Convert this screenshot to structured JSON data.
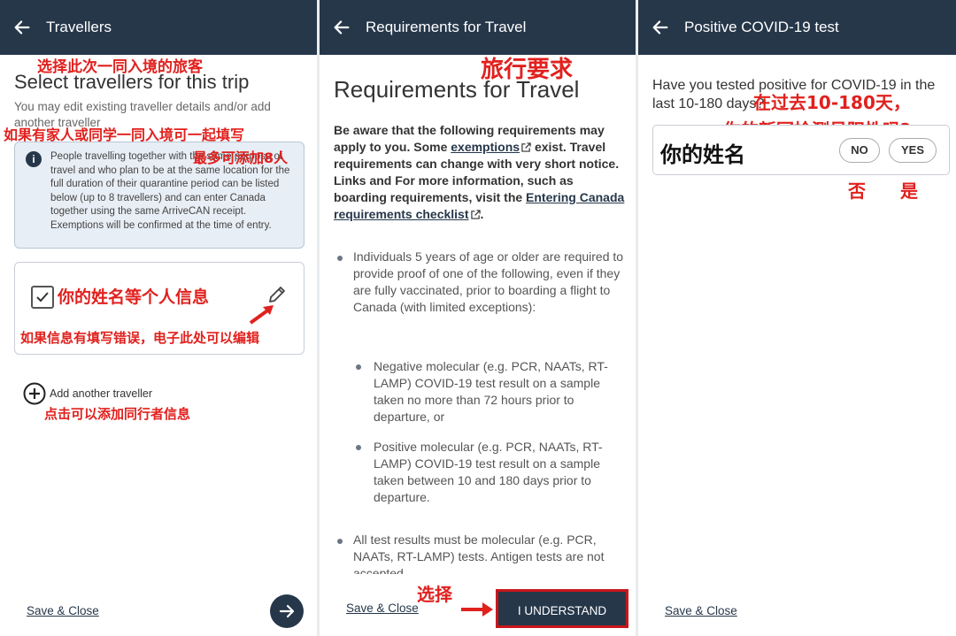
{
  "panels": {
    "travellers": {
      "title": "Travellers",
      "heading": "Select travellers for this trip",
      "subtext": "You may edit existing traveller details and/or add another traveller",
      "info_text": "People travelling together with the same purpose of travel and who plan to be at the same location for the full duration of their quarantine period can be listed below (up to 8 travellers) and can enter Canada together using the same ArriveCAN receipt. Exemptions will be confirmed at the time of entry.",
      "add_label": "Add another traveller",
      "save_close": "Save & Close"
    },
    "requirements": {
      "title": "Requirements for Travel",
      "heading": "Requirements for Travel",
      "intro_pre": "Be aware that the following requirements may apply to you. Some ",
      "intro_link1": "exemptions",
      "intro_mid": " exist. Travel requirements can change with very short notice. Links and For more information, such as boarding requirements, visit the ",
      "intro_link2": "Entering Canada requirements checklist",
      "intro_end": ".",
      "bullet1": "Individuals 5 years of age or older are required to provide proof of one of the following, even if they are fully vaccinated, prior to boarding a flight to Canada (with limited exceptions):",
      "sub1": "Negative molecular (e.g. PCR, NAATs, RT-LAMP) COVID-19 test result on a sample taken no more than 72 hours prior to departure, or",
      "sub2": "Positive molecular (e.g. PCR, NAATs, RT-LAMP) COVID-19 test result on a sample taken between 10 and 180 days prior to departure.",
      "bullet2": "All test results must be molecular (e.g. PCR, NAATs, RT-LAMP) tests. Antigen tests are not accepted.",
      "save_close": "Save & Close",
      "understand": "I UNDERSTAND"
    },
    "covid": {
      "title": "Positive COVID-19 test",
      "question": "Have you tested positive for COVID-19 in the last 10-180 days?",
      "no": "NO",
      "yes": "YES",
      "save_close": "Save & Close"
    }
  },
  "annotations": {
    "a1": "选择此次一同入境的旅客",
    "a2": "如果有家人或同学一同入境可一起填写",
    "a3": "最多可添加8人",
    "a4": "你的姓名等个人信息",
    "a5": "如果信息有填写错误，电子此处可以编辑",
    "a6": "点击可以添加同行者信息",
    "a7": "旅行要求",
    "a8": "选择",
    "a9": "在过去10-180天，",
    "a10": "你的新冠检测呈阳性吗?",
    "a11": "你的姓名",
    "a12": "否",
    "a13": "是"
  },
  "colors": {
    "header": "#26374a",
    "annotation": "#e0211e",
    "highlight_border": "#c8161b"
  }
}
